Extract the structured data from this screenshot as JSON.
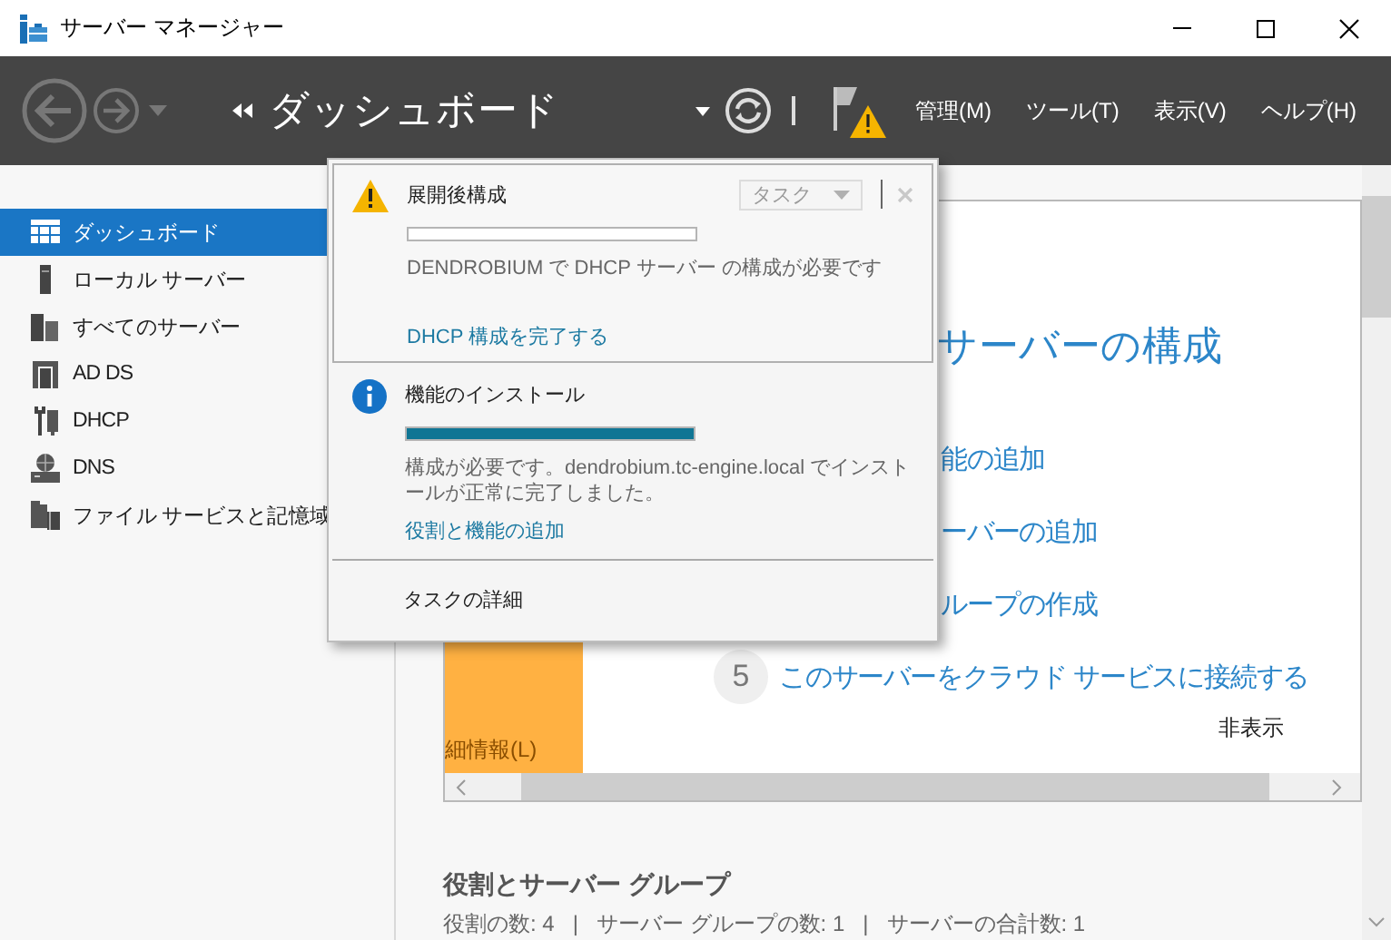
{
  "window": {
    "title": "サーバー マネージャー"
  },
  "header": {
    "breadcrumb": "ダッシュボード",
    "menu": [
      {
        "label": "管理(M)"
      },
      {
        "label": "ツール(T)"
      },
      {
        "label": "表示(V)"
      },
      {
        "label": "ヘルプ(H)"
      }
    ]
  },
  "sidebar": {
    "items": [
      {
        "label": "ダッシュボード",
        "selected": true
      },
      {
        "label": "ローカル サーバー",
        "selected": false
      },
      {
        "label": "すべてのサーバー",
        "selected": false
      },
      {
        "label": "AD DS",
        "selected": false
      },
      {
        "label": "DHCP",
        "selected": false
      },
      {
        "label": "DNS",
        "selected": false
      },
      {
        "label": "ファイル サービスと記憶域",
        "selected": false
      }
    ]
  },
  "quick_start": {
    "heading": "サーバーの構成",
    "steps": [
      {
        "label": "能の追加"
      },
      {
        "label": "ーバーの追加"
      },
      {
        "label": "ループの作成"
      },
      {
        "number": "5",
        "label": "このサーバーをクラウド サービスに接続する"
      }
    ],
    "learn_more": "細情報(L)",
    "hide": "非表示"
  },
  "roles_section": {
    "title": "役割とサーバー グループ",
    "summary": "役割の数: 4   |   サーバー グループの数: 1   |   サーバーの合計数: 1"
  },
  "notifications": {
    "items": [
      {
        "kind": "warning",
        "selected": true,
        "title": "展開後構成",
        "level": 0,
        "message": "DENDROBIUM で DHCP サーバー の構成が必要です",
        "link": "DHCP 構成を完了する",
        "tasks_button": {
          "label": "タスク",
          "disabled": true
        }
      },
      {
        "kind": "info",
        "selected": false,
        "title": "機能のインストール",
        "level": 1,
        "message": "構成が必要です。dendrobium.tc-engine.local でインストールが正常に完了しました。",
        "link": "役割と機能の追加"
      }
    ],
    "footer": "タスクの詳細"
  }
}
